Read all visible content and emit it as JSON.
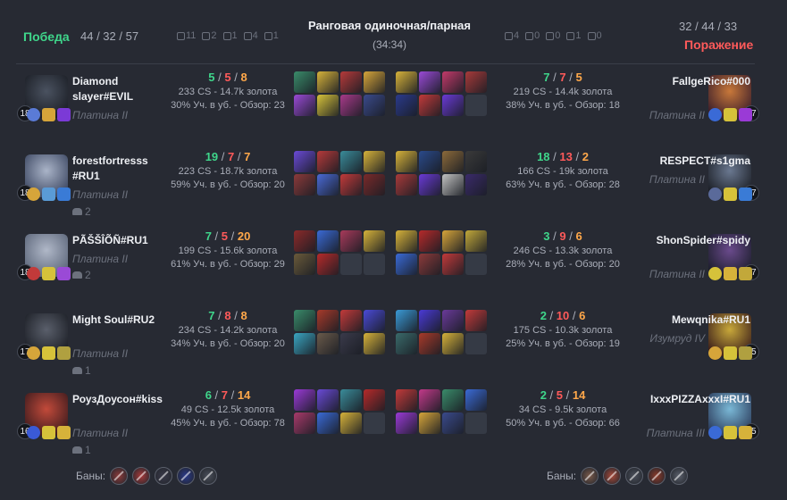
{
  "header": {
    "mode": "Ранговая одиночная/парная",
    "duration": "(34:34)",
    "blue": {
      "result": "Победа",
      "kda": "44 / 32 / 57",
      "objectives": [
        {
          "icon": "tower-icon",
          "value": "11"
        },
        {
          "icon": "inhibitor-icon",
          "value": "2"
        },
        {
          "icon": "baron-icon",
          "value": "1"
        },
        {
          "icon": "dragon-icon",
          "value": "4"
        },
        {
          "icon": "herald-icon",
          "value": "1"
        }
      ]
    },
    "red": {
      "result": "Поражение",
      "kda": "32 / 44 / 33",
      "objectives": [
        {
          "icon": "tower-icon",
          "value": "4"
        },
        {
          "icon": "inhibitor-icon",
          "value": "0"
        },
        {
          "icon": "baron-icon",
          "value": "0"
        },
        {
          "icon": "dragon-icon",
          "value": "1"
        },
        {
          "icon": "herald-icon",
          "value": "0"
        }
      ]
    }
  },
  "labels": {
    "bans": "Баны:"
  },
  "blue_players": [
    {
      "name": "Diamond slayer#EVIL",
      "rank": "Платина II",
      "party": "",
      "level": "18",
      "kills": "5",
      "deaths": "5",
      "assists": "8",
      "cs_gold": "233 CS - 14.7k золота",
      "kp_vision": "30% Уч. в уб. - Обзор: 23",
      "colors": {
        "portrait": [
          "#4a5260",
          "#1a1d24"
        ],
        "runes": [
          "#5a7bd6",
          "#d6a53a",
          "#7b3ad6"
        ],
        "items": [
          "#3a8c6a",
          "#d6b23a",
          "#b63a3a",
          "#d6a53a",
          "#9a4ad6",
          "#d6c23a",
          "#a83a8a",
          "#3a4a8c"
        ]
      }
    },
    {
      "name": "forestfortresss #RU1",
      "rank": "Платина II",
      "party": "2",
      "level": "18",
      "kills": "19",
      "deaths": "7",
      "assists": "7",
      "cs_gold": "223 CS - 18.7k золота",
      "kp_vision": "59% Уч. в уб. - Обзор: 20",
      "colors": {
        "portrait": [
          "#aab4c8",
          "#3a4560"
        ],
        "runes": [
          "#d6a53a",
          "#5a9bd6",
          "#3a7bd6"
        ],
        "items": [
          "#6a4ad6",
          "#b63a3a",
          "#3a8c9a",
          "#d6b23a",
          "#8c3a3a",
          "#4a6ad6",
          "#c23a3a",
          "#7a2a2a"
        ]
      }
    },
    {
      "name": "PÃŠŠÎÕÑ#RU1",
      "rank": "Платина II",
      "party": "2",
      "level": "18",
      "kills": "7",
      "deaths": "5",
      "assists": "20",
      "cs_gold": "199 CS - 15.6k золота",
      "kp_vision": "61% Уч. в уб. - Обзор: 29",
      "colors": {
        "portrait": [
          "#b0b8c8",
          "#5a6478"
        ],
        "runes": [
          "#c23a3a",
          "#d6c23a",
          "#9a4ad6"
        ],
        "items": [
          "#8c2a2a",
          "#3a6ad6",
          "#a83a5a",
          "#d6b23a",
          "#6a5a3a",
          "#b62a2a"
        ]
      }
    },
    {
      "name": "Might Soul#RU2",
      "rank": "Платина II",
      "party": "1",
      "level": "17",
      "kills": "7",
      "deaths": "8",
      "assists": "8",
      "cs_gold": "234 CS - 14.2k золота",
      "kp_vision": "34% Уч. в уб. - Обзор: 20",
      "colors": {
        "portrait": [
          "#5a5f6b",
          "#1a1d24"
        ],
        "runes": [
          "#d6a53a",
          "#d6c23a",
          "#b0a040"
        ],
        "items": [
          "#3a8c6a",
          "#a83a2a",
          "#c23a3a",
          "#4a4ad6",
          "#3aa6c2",
          "#6a5a4a",
          "#3a3a4a",
          "#d6b23a"
        ]
      }
    },
    {
      "name": "РоузДоусон#kiss",
      "rank": "Платина II",
      "party": "1",
      "level": "16",
      "kills": "6",
      "deaths": "7",
      "assists": "14",
      "cs_gold": "49 CS - 12.5k золота",
      "kp_vision": "45% Уч. в уб. - Обзор: 78",
      "colors": {
        "portrait": [
          "#c24a3a",
          "#3a1a1d"
        ],
        "runes": [
          "#3a5ad6",
          "#d6c23a",
          "#d6b23a"
        ],
        "items": [
          "#9a3ad6",
          "#6a4ad6",
          "#3a8c9a",
          "#b62a2a",
          "#a83a6a",
          "#3a6ad6",
          "#d6b23a"
        ]
      }
    }
  ],
  "red_players": [
    {
      "name": "FallgeRico#000",
      "rank": "Платина II",
      "level": "17",
      "kills": "7",
      "deaths": "7",
      "assists": "5",
      "cs_gold": "219 CS - 14.4k золота",
      "kp_vision": "38% Уч. в уб. - Обзор: 18",
      "colors": {
        "portrait": [
          "#c8783a",
          "#3a1d2a"
        ],
        "runes": [
          "#3a6ad6",
          "#d6c23a",
          "#9a3ad6"
        ],
        "items": [
          "#d6b23a",
          "#9a4ad6",
          "#c23a6a",
          "#a83a3a",
          "#2a3a8c",
          "#c23a3a",
          "#6a3ad6"
        ]
      }
    },
    {
      "name": "RESPECT#s1gma",
      "rank": "Платина II",
      "level": "17",
      "kills": "18",
      "deaths": "13",
      "assists": "2",
      "cs_gold": "166 CS - 19k золота",
      "kp_vision": "63% Уч. в уб. - Обзор: 28",
      "colors": {
        "portrait": [
          "#6a7890",
          "#1a1d24"
        ],
        "runes": [
          "#5a6a9a",
          "#d6c23a",
          "#3a7bd6"
        ],
        "items": [
          "#d6b23a",
          "#2a4a8c",
          "#8c6a3a",
          "#3a3a3a",
          "#a83a3a",
          "#6a3ad6",
          "#c2c2c2",
          "#3a2a6a"
        ]
      }
    },
    {
      "name": "ShonSpider#spidy",
      "rank": "Платина II",
      "level": "17",
      "kills": "3",
      "deaths": "9",
      "assists": "6",
      "cs_gold": "246 CS - 13.3k золота",
      "kp_vision": "28% Уч. в уб. - Обзор: 20",
      "colors": {
        "portrait": [
          "#6a4a8c",
          "#1a1d2a"
        ],
        "runes": [
          "#d6c23a",
          "#d6b23a",
          "#c2a83a"
        ],
        "items": [
          "#d6b23a",
          "#b62a2a",
          "#d6a53a",
          "#c2a83a",
          "#3a6ad6",
          "#8c3a3a",
          "#c23a3a"
        ]
      }
    },
    {
      "name": "Mewqnika#RU1",
      "rank": "Изумруд IV",
      "level": "15",
      "kills": "2",
      "deaths": "10",
      "assists": "6",
      "cs_gold": "175 CS - 10.3k золота",
      "kp_vision": "25% Уч. в уб. - Обзор: 19",
      "colors": {
        "portrait": [
          "#c8a83a",
          "#3a1d1a"
        ],
        "runes": [
          "#d6a53a",
          "#d6c23a",
          "#b0a040"
        ],
        "items": [
          "#3a9ad6",
          "#4a3ad6",
          "#6a3a9a",
          "#c23a3a",
          "#3a6a6a",
          "#a83a2a",
          "#d6b23a"
        ]
      }
    },
    {
      "name": "IxxxPIZZAxxxI#RU1",
      "rank": "Платина III",
      "level": "15",
      "kills": "2",
      "deaths": "5",
      "assists": "14",
      "cs_gold": "34 CS - 9.5k золота",
      "kp_vision": "50% Уч. в уб. - Обзор: 66",
      "colors": {
        "portrait": [
          "#7ab8d6",
          "#2a3a5a"
        ],
        "runes": [
          "#3a6ad6",
          "#d6c23a",
          "#d6b23a"
        ],
        "items": [
          "#c23a3a",
          "#c23a8a",
          "#3a8c6a",
          "#3a6ad6",
          "#9a3ad6",
          "#d6a53a",
          "#3a4a8c"
        ]
      }
    }
  ],
  "bans": {
    "blue": [
      {
        "color": "#8c3a3a"
      },
      {
        "color": "#a83a3a"
      },
      {
        "color": "#3a3a4a"
      },
      {
        "color": "#2a3a8c"
      },
      {
        "color": "#4a4f5a"
      }
    ],
    "red": [
      {
        "color": "#7a5a4a"
      },
      {
        "color": "#a84a3a"
      },
      {
        "color": "#4a4f5a"
      },
      {
        "color": "#8c3a2a"
      },
      {
        "color": "#5a5f6b"
      }
    ]
  }
}
